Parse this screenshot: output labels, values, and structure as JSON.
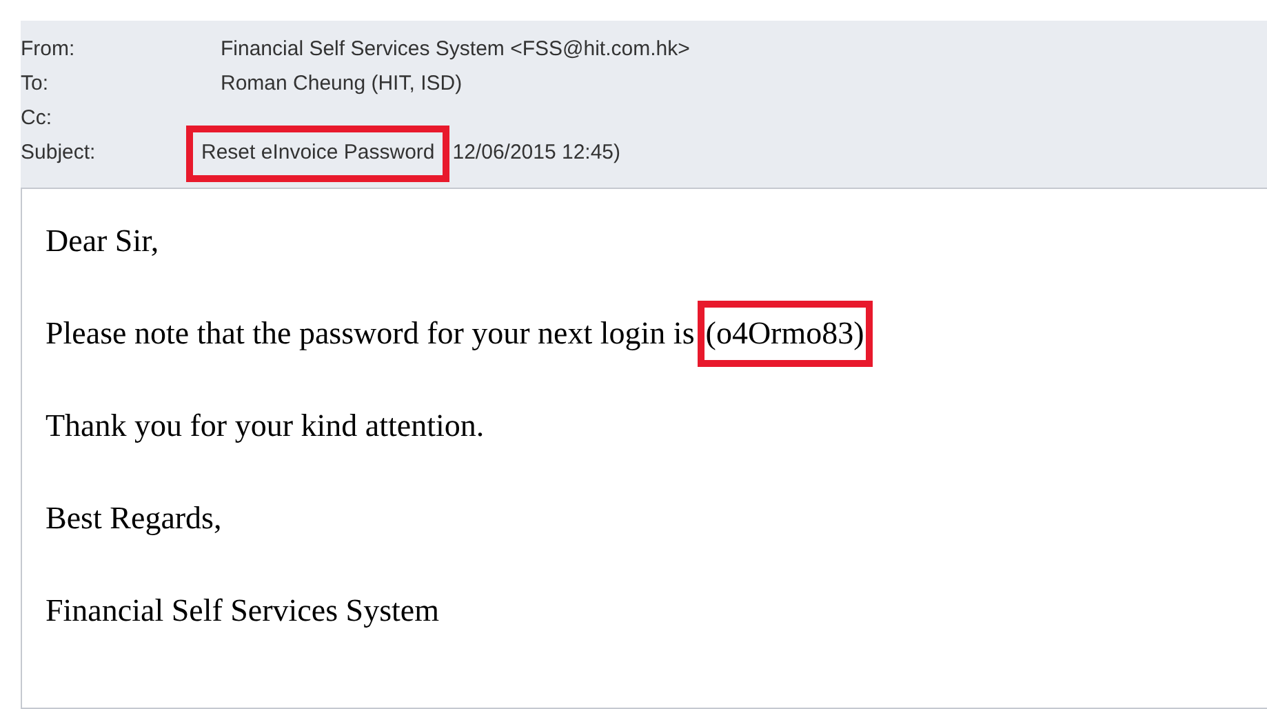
{
  "header": {
    "fields": [
      {
        "label": "From:",
        "value": "Financial Self Services System <FSS@hit.com.hk>",
        "highlighted": false
      },
      {
        "label": "To:",
        "value": "Roman Cheung (HIT, ISD)",
        "highlighted": false
      },
      {
        "label": "Cc:"
      },
      {
        "label": "Subject:",
        "value": "Reset eInvoice Password",
        "highlighted": true,
        "after": "12/06/2015 12:45)"
      }
    ]
  },
  "body": {
    "paragraphs": [
      {
        "text": "Dear Sir,"
      },
      {
        "text": "Please note that the password for your next login is",
        "highlight_text": "(o4Ormo83)",
        "highlighted": true
      },
      {
        "text": "Thank you for your kind attention."
      },
      {
        "text": "Best Regards,"
      },
      {
        "text": "Financial Self Services System"
      }
    ]
  }
}
